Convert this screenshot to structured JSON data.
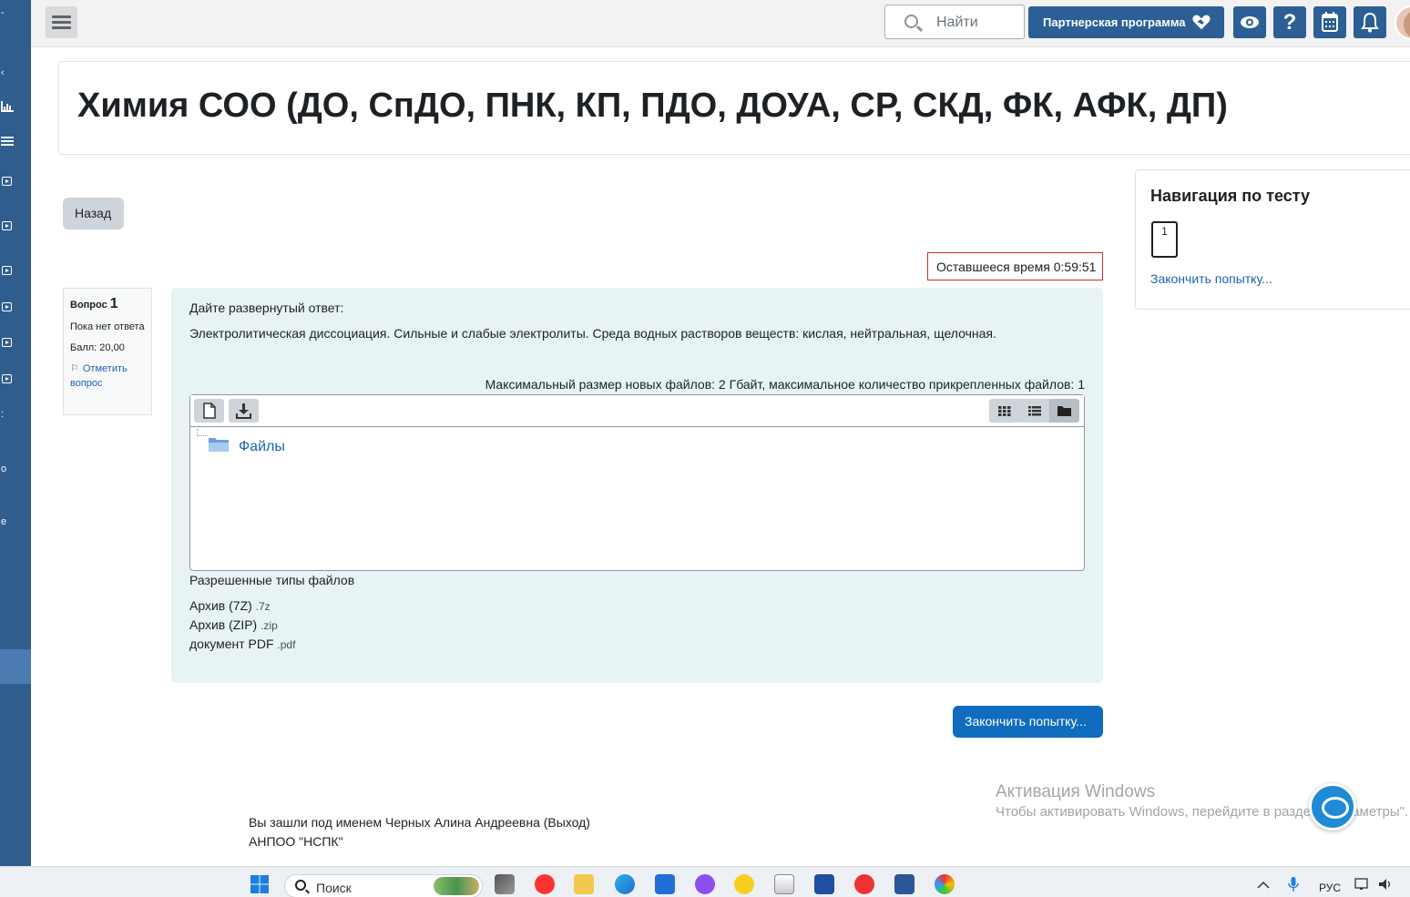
{
  "navbar": {
    "search_placeholder": "Найти",
    "partner_label": "Партнерская программа",
    "icons": [
      "menu-icon",
      "search-icon",
      "handshake-icon",
      "eye-icon",
      "help-icon",
      "calendar-icon",
      "bell-icon"
    ]
  },
  "course": {
    "title": "Химия СОО (ДО, СпДО, ПНК, КП, ПДО, ДОУА, СР, СКД, ФК, АФК, ДП)"
  },
  "back_label": "Назад",
  "timer": "Оставшееся время 0:59:51",
  "question_info": {
    "label": "Вопрос",
    "number": "1",
    "state": "Пока нет ответа",
    "grade": "Балл: 20,00",
    "flag_label": "Отметить вопрос"
  },
  "question": {
    "prompt": "Дайте развернутый ответ:",
    "text": "Электролитическая диссоциация. Сильные и слабые электролиты. Среда водных растворов веществ: кислая, нейтральная, щелочная.",
    "max_size": "Максимальный размер новых файлов: 2 Гбайт, максимальное количество прикрепленных файлов: 1",
    "folder_label": "Файлы",
    "allowed_title": "Разрешенные типы файлов",
    "allowed_types": [
      {
        "name": "Архив (7Z)",
        "ext": ".7z"
      },
      {
        "name": "Архив (ZIP)",
        "ext": ".zip"
      },
      {
        "name": "документ PDF",
        "ext": ".pdf"
      }
    ]
  },
  "finish_label": "Закончить попытку...",
  "quiz_nav": {
    "title": "Навигация по тесту",
    "question_number": "1",
    "finish_link": "Закончить попытку..."
  },
  "footer": {
    "logged_in": "Вы зашли под именем Черных Алина Андреевна (Выход)",
    "org": "АНПОО \"НСПК\""
  },
  "watermark": {
    "title": "Активация Windows",
    "subtitle": "Чтобы активировать Windows, перейдите в раздел \"Параметры\"."
  },
  "taskbar": {
    "search_placeholder": "Поиск",
    "language": "РУС"
  }
}
